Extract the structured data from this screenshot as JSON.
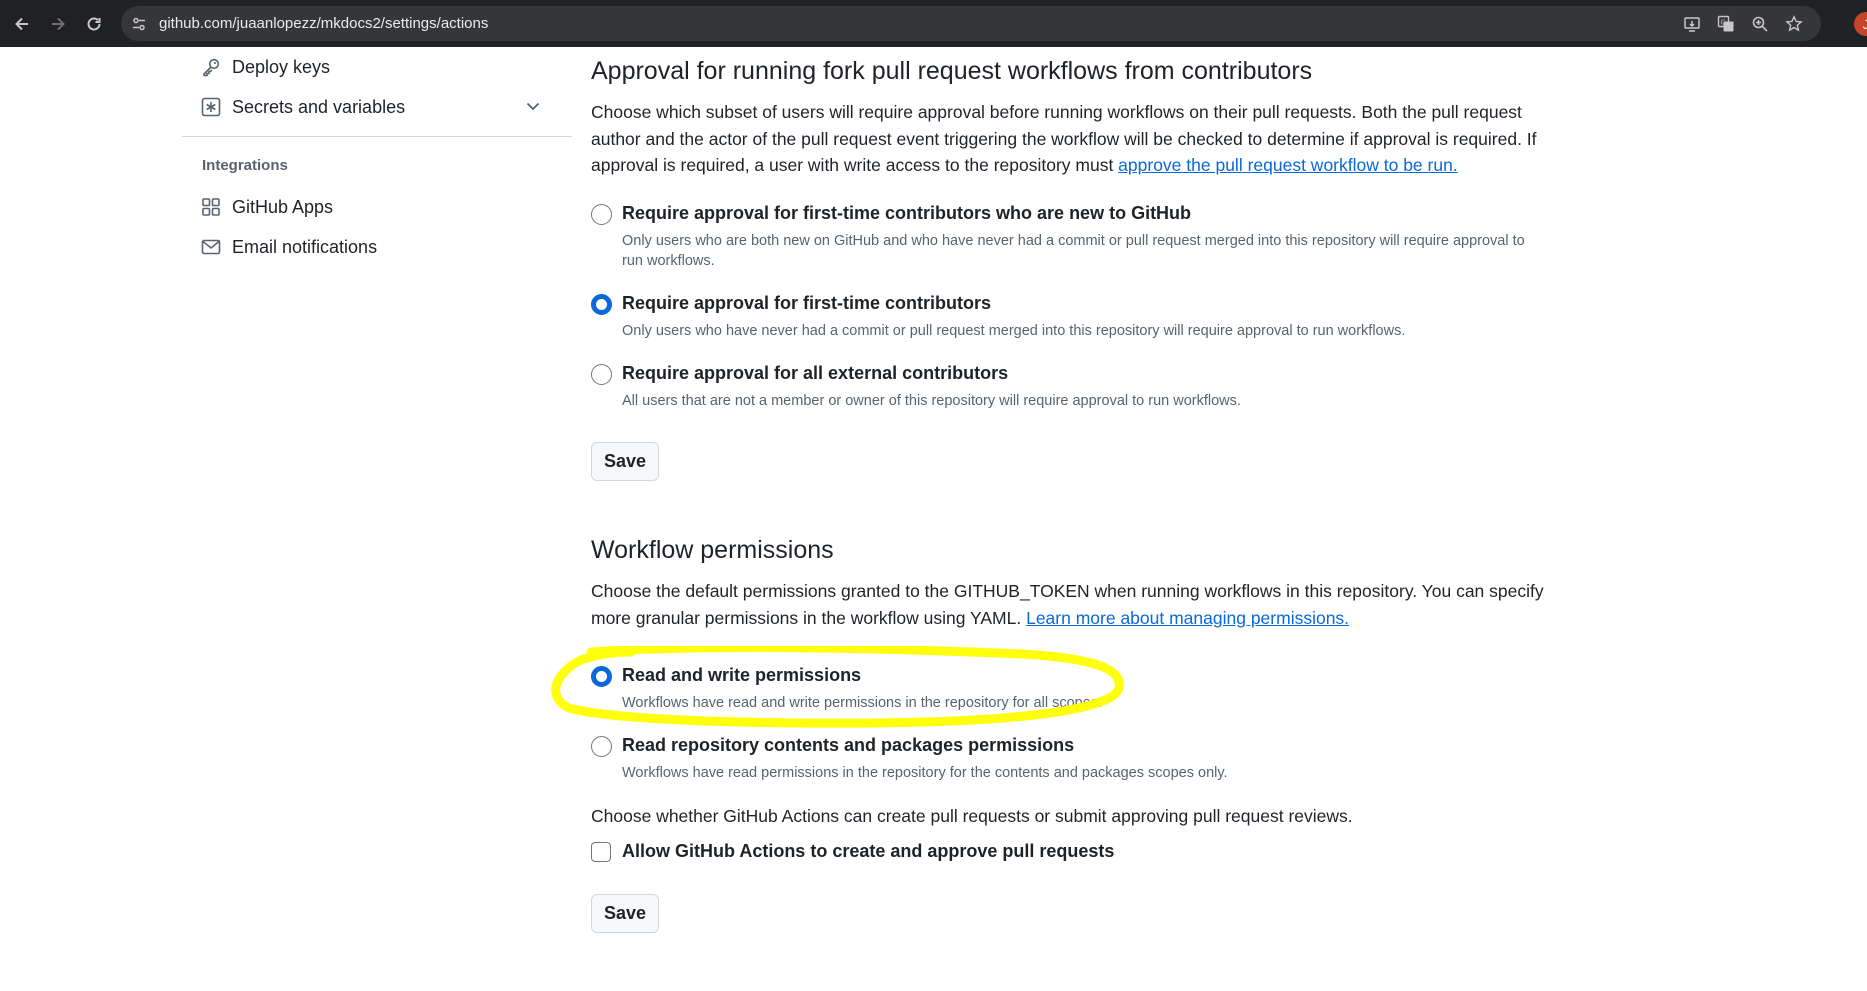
{
  "browser": {
    "url": "github.com/juaanlopezz/mkdocs2/settings/actions",
    "profile_initial": "J"
  },
  "sidebar": {
    "items": [
      {
        "label": "Deploy keys",
        "icon": "key-icon"
      },
      {
        "label": "Secrets and variables",
        "icon": "asterisk-square-icon"
      },
      {
        "label": "GitHub Apps",
        "icon": "apps-grid-icon"
      },
      {
        "label": "Email notifications",
        "icon": "mail-icon"
      }
    ],
    "integrations_heading": "Integrations"
  },
  "fork_approval": {
    "title": "Approval for running fork pull request workflows from contributors",
    "description": "Choose which subset of users will require approval before running workflows on their pull requests. Both the pull request author and the actor of the pull request event triggering the workflow will be checked to determine if approval is required. If approval is required, a user with write access to the repository must ",
    "description_link": "approve the pull request workflow to be run.",
    "options": [
      {
        "label": "Require approval for first-time contributors who are new to GitHub",
        "description": "Only users who are both new on GitHub and who have never had a commit or pull request merged into this repository will require approval to run workflows.",
        "checked": false
      },
      {
        "label": "Require approval for first-time contributors",
        "description": "Only users who have never had a commit or pull request merged into this repository will require approval to run workflows.",
        "checked": true
      },
      {
        "label": "Require approval for all external contributors",
        "description": "All users that are not a member or owner of this repository will require approval to run workflows.",
        "checked": false
      }
    ],
    "save_label": "Save"
  },
  "workflow_permissions": {
    "title": "Workflow permissions",
    "description": "Choose the default permissions granted to the GITHUB_TOKEN when running workflows in this repository. You can specify more granular permissions in the workflow using YAML. ",
    "description_link": "Learn more about managing permissions.",
    "options": [
      {
        "label": "Read and write permissions",
        "description": "Workflows have read and write permissions in the repository for all scopes.",
        "checked": true
      },
      {
        "label": "Read repository contents and packages permissions",
        "description": "Workflows have read permissions in the repository for the contents and packages scopes only.",
        "checked": false
      }
    ],
    "pr_text": "Choose whether GitHub Actions can create pull requests or submit approving pull request reviews.",
    "pr_checkbox_label": "Allow GitHub Actions to create and approve pull requests",
    "pr_checkbox_checked": false,
    "save_label": "Save"
  },
  "colors": {
    "accent": "#0969da",
    "highlight": "#ffff00",
    "chrome_bg": "#202124"
  }
}
